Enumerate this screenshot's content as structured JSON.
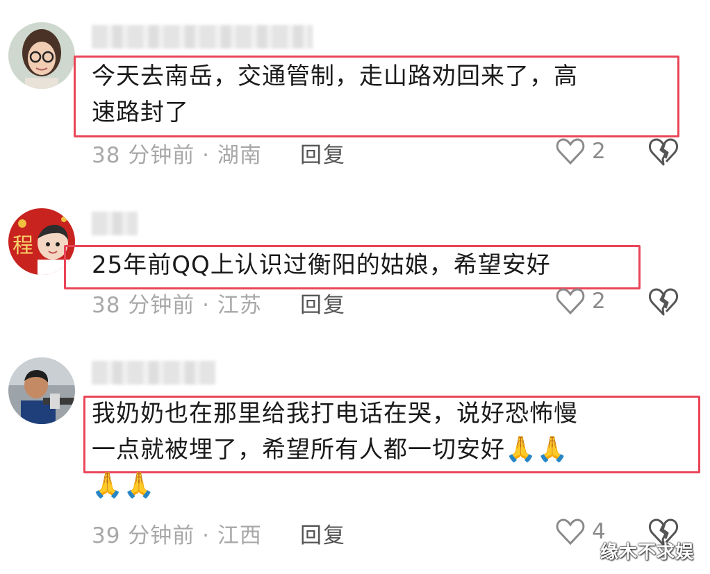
{
  "comments": [
    {
      "text_line1": "今天去南岳，交通管制，走山路劝回来了，高",
      "text_line2": "速路封了",
      "meta": "38 分钟前 · 湖南",
      "reply": "回复",
      "likes": "2"
    },
    {
      "text_line1": "25年前QQ上认识过衡阳的姑娘，希望安好",
      "meta": "38 分钟前 · 江苏",
      "reply": "回复",
      "likes": "2"
    },
    {
      "text_line1": "我奶奶也在那里给我打电话在哭，说好恐怖慢",
      "text_line2": "一点就被埋了，希望所有人都一切安好",
      "emoji_line2": "🙏🙏",
      "emoji_line3": "🙏🙏",
      "meta": "39 分钟前 · 江西",
      "reply": "回复",
      "likes": "4"
    }
  ],
  "watermark": "缘木不求娱",
  "colors": {
    "highlight_border": "#e94558",
    "meta_text": "#a8a8a8"
  },
  "icons": {
    "like": "heart-outline-icon",
    "dislike": "broken-heart-icon"
  }
}
